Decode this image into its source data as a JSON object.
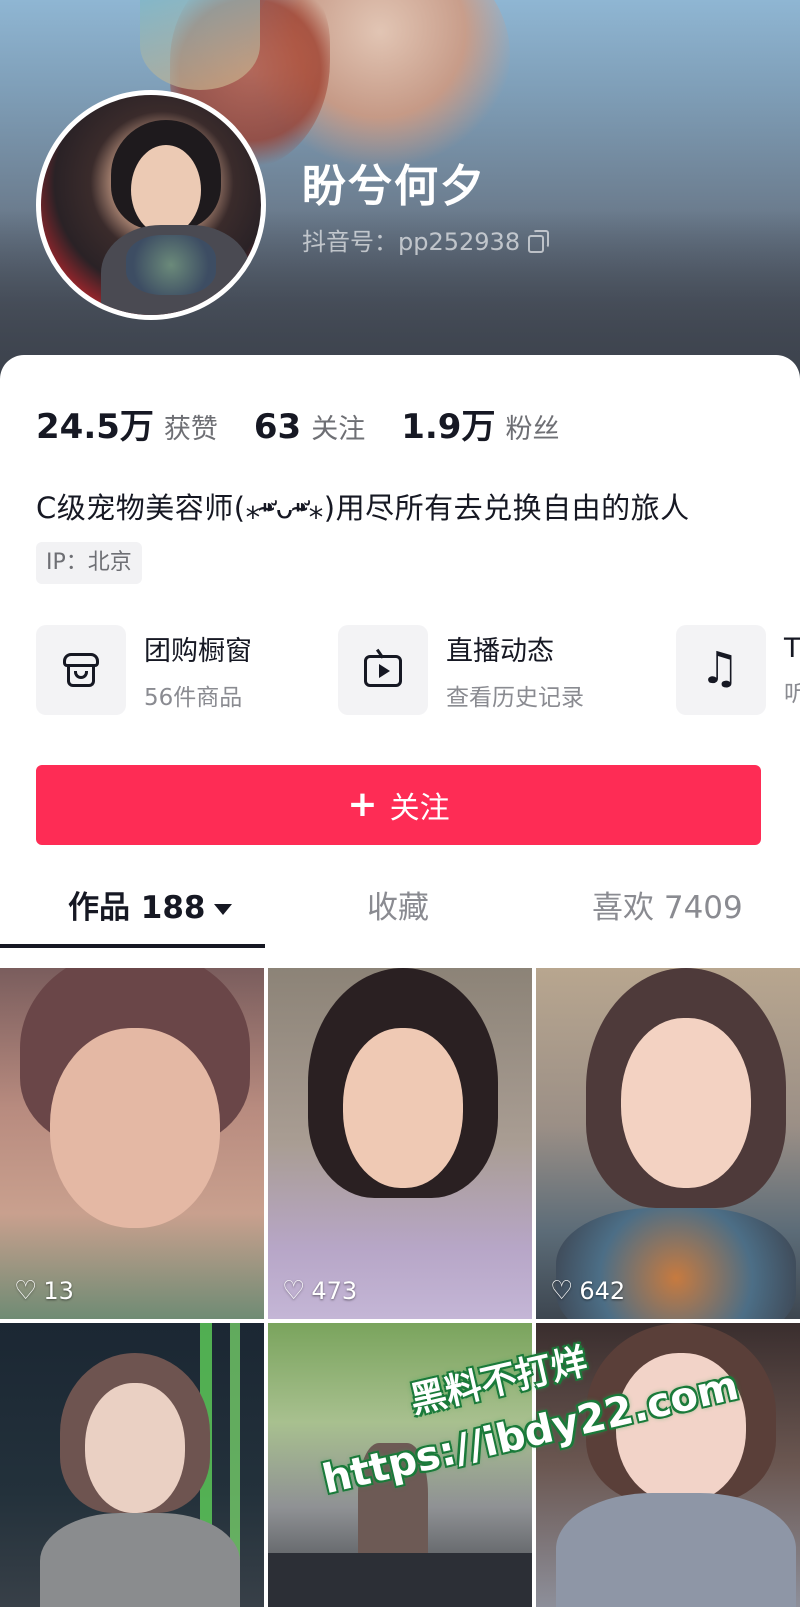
{
  "profile": {
    "name": "盼兮何夕",
    "douyin_id": "抖音号：pp252938",
    "stats": [
      {
        "value": "24.5万",
        "label": "获赞"
      },
      {
        "value": "63",
        "label": "关注"
      },
      {
        "value": "1.9万",
        "label": "粉丝"
      }
    ],
    "bio": "C级宠物美容师(⁎⁍̴̛ᴗ⁍̴̛⁎)用尽所有去兑换自由的旅人",
    "ip": "IP：北京"
  },
  "shortcuts": [
    {
      "title": "团购橱窗",
      "subtitle": "56件商品",
      "icon": "shop-icon"
    },
    {
      "title": "直播动态",
      "subtitle": "查看历史记录",
      "icon": "tv-icon"
    },
    {
      "title": "T",
      "subtitle": "听",
      "icon": "music-note-icon"
    }
  ],
  "follow_button": {
    "label": "关注",
    "icon": "plus-icon"
  },
  "tabs": [
    {
      "label": "作品 188",
      "active": true
    },
    {
      "label": "收藏",
      "active": false
    },
    {
      "label": "喜欢 7409",
      "active": false
    }
  ],
  "videos": [
    {
      "likes": "13"
    },
    {
      "likes": "473"
    },
    {
      "likes": "642"
    },
    {
      "likes": ""
    },
    {
      "likes": ""
    },
    {
      "likes": ""
    }
  ],
  "watermark": {
    "line1": "黑料不打烊",
    "line2": "https://ibdy22.com"
  },
  "colors": {
    "accent": "#fe2c55",
    "text_primary": "#161823",
    "text_secondary": "#8a8b91"
  }
}
